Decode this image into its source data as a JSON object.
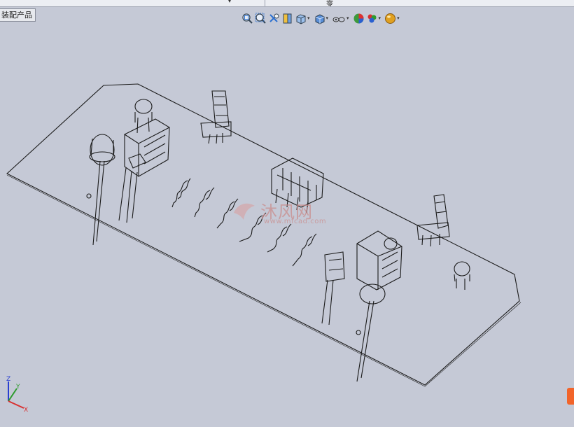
{
  "top_strip": {
    "dropdown_glyph": "▾",
    "char": "零"
  },
  "document_tab": {
    "label": "装配产品"
  },
  "heads_up_toolbar": {
    "buttons": [
      {
        "icon": "zoom-to-fit-icon",
        "dropdown": false
      },
      {
        "icon": "zoom-to-area-icon",
        "dropdown": false
      },
      {
        "icon": "previous-view-icon",
        "dropdown": false
      },
      {
        "icon": "section-view-icon",
        "dropdown": false
      },
      {
        "icon": "view-orientation-icon",
        "dropdown": true
      },
      {
        "icon": "display-style-icon",
        "dropdown": true
      },
      {
        "icon": "hide-show-items-icon",
        "dropdown": true
      },
      {
        "icon": "edit-appearance-icon",
        "dropdown": false
      },
      {
        "icon": "apply-scene-icon",
        "dropdown": true
      },
      {
        "icon": "view-settings-icon",
        "dropdown": true
      }
    ],
    "dropdown_glyph": "▾"
  },
  "watermark": {
    "title": "沐风网",
    "url": "www.mfcad.com"
  },
  "triad": {
    "x": "X",
    "y": "Y",
    "z": "Z"
  },
  "colors": {
    "viewport_bg": "#c5c9d6",
    "line": "#1a1a1a",
    "triad_x": "#d83030",
    "triad_y": "#2c9a2c",
    "triad_z": "#2a3fd0",
    "badge": "#f2642a"
  }
}
